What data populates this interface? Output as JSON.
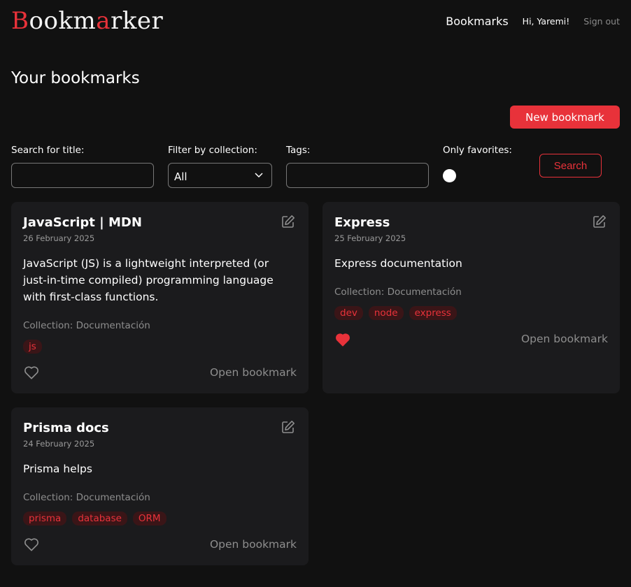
{
  "header": {
    "logo_parts": [
      "B",
      "ook",
      "m",
      "a",
      "rker"
    ],
    "nav_bookmarks": "Bookmarks",
    "greeting": "Hi, Yaremi!",
    "sign_out": "Sign out"
  },
  "page_title": "Your bookmarks",
  "new_bookmark_label": "New bookmark",
  "filters": {
    "title_label": "Search for title:",
    "title_value": "",
    "collection_label": "Filter by collection:",
    "collection_value": "All",
    "tags_label": "Tags:",
    "tags_value": "",
    "favorites_label": "Only favorites:",
    "favorites_checked": false,
    "search_label": "Search"
  },
  "cards": [
    {
      "title": "JavaScript | MDN",
      "date": "26 February 2025",
      "description": "JavaScript (JS) is a lightweight interpreted (or just-in-time compiled) programming language with first-class functions.",
      "collection": "Collection: Documentación",
      "tags": [
        "js"
      ],
      "favorite": false,
      "open_label": "Open bookmark"
    },
    {
      "title": "Express",
      "date": "25 February 2025",
      "description": "Express documentation",
      "collection": "Collection: Documentación",
      "tags": [
        "dev",
        "node",
        "express"
      ],
      "favorite": true,
      "open_label": "Open bookmark"
    },
    {
      "title": "Prisma docs",
      "date": "24 February 2025",
      "description": "Prisma helps",
      "collection": "Collection: Documentación",
      "tags": [
        "prisma",
        "database",
        "ORM"
      ],
      "favorite": false,
      "open_label": "Open bookmark"
    }
  ],
  "colors": {
    "accent": "#e8323a",
    "background": "#111111",
    "card": "#1b1b1d",
    "tag_bg": "#3a1517",
    "muted": "#8e8e8e"
  }
}
